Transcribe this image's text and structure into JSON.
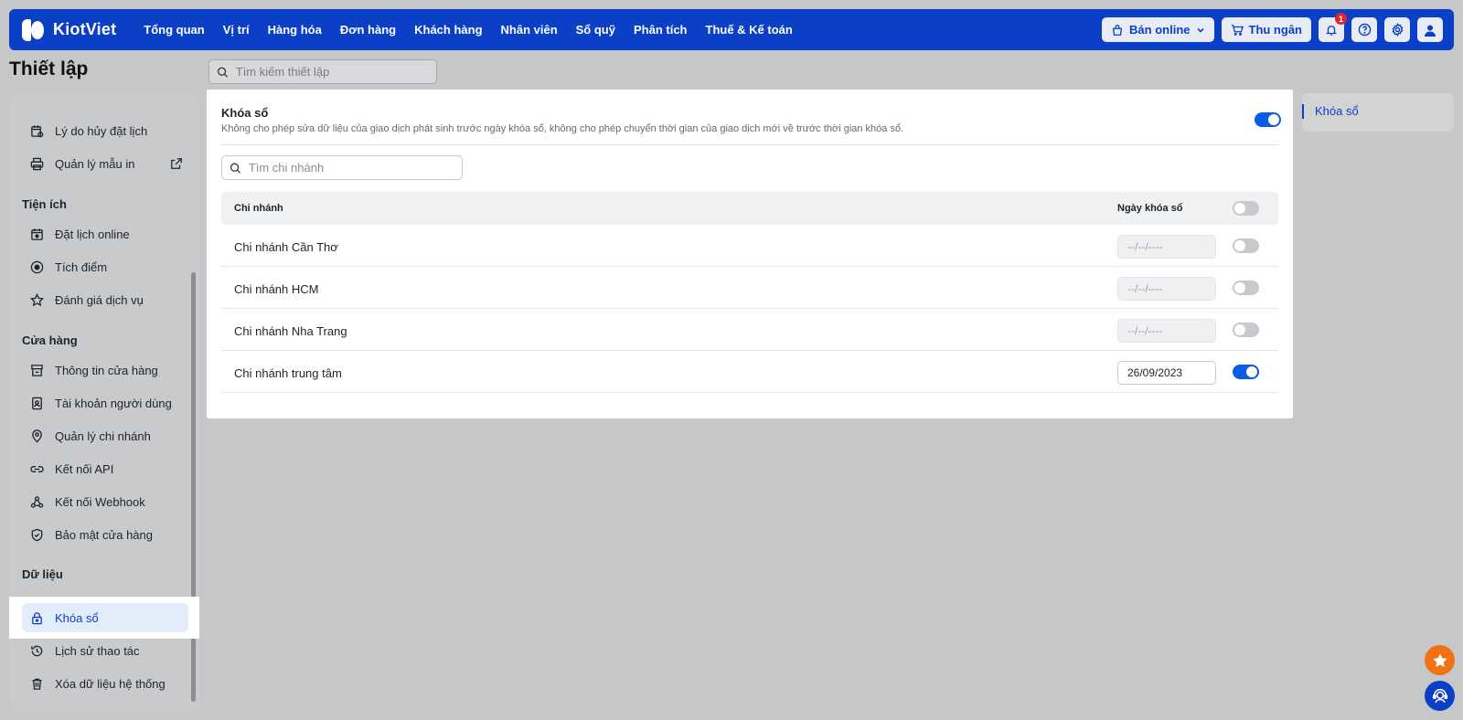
{
  "app": {
    "brand": "KiotViet",
    "nav": [
      "Tổng quan",
      "Vị trí",
      "Hàng hóa",
      "Đơn hàng",
      "Khách hàng",
      "Nhân viên",
      "Sổ quỹ",
      "Phân tích",
      "Thuế & Kế toán"
    ],
    "sell_online": "Bán online",
    "cashier": "Thu ngân",
    "notification_count": "1"
  },
  "page": {
    "title": "Thiết lập",
    "search_placeholder": "Tìm kiếm thiết lập"
  },
  "sidebar": {
    "top_items": [
      "Lý do hủy đặt lịch",
      "Quản lý mẫu in"
    ],
    "section_utilities": "Tiện ích",
    "utilities": [
      "Đặt lịch online",
      "Tích điểm",
      "Đánh giá dịch vụ"
    ],
    "section_store": "Cửa hàng",
    "store": [
      "Thông tin cửa hàng",
      "Tài khoản người dùng",
      "Quản lý chi nhánh",
      "Kết nối API",
      "Kết nối Webhook",
      "Bảo mật cửa hàng"
    ],
    "section_data": "Dữ liệu",
    "data": [
      "Khóa sổ",
      "Lịch sử thao tác",
      "Xóa dữ liệu hệ thống"
    ]
  },
  "lock": {
    "title": "Khóa sổ",
    "description": "Không cho phép sửa dữ liệu của giao dịch phát sinh trước ngày khóa sổ, không cho phép chuyển thời gian của giao dịch mới về trước thời gian khóa sổ.",
    "enabled": true,
    "branch_search_placeholder": "Tìm chi nhánh",
    "col_branch": "Chi nhánh",
    "col_date": "Ngày khóa sổ",
    "rows": [
      {
        "name": "Chi nhánh Cần Thơ",
        "date": "--/--/----",
        "on": false
      },
      {
        "name": "Chi nhánh HCM",
        "date": "--/--/----",
        "on": false
      },
      {
        "name": "Chi nhánh Nha Trang",
        "date": "--/--/----",
        "on": false
      },
      {
        "name": "Chi nhánh trung tâm",
        "date": "26/09/2023",
        "on": true
      }
    ]
  },
  "right_panel": {
    "link": "Khóa sổ"
  },
  "colors": {
    "brand_blue": "#0a3fc6",
    "toggle_on": "#0a5be6",
    "fab_orange": "#f07213"
  }
}
